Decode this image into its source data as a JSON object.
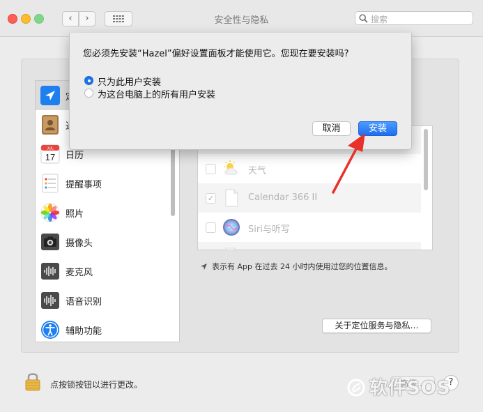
{
  "window": {
    "title": "安全性与隐私"
  },
  "toolbar": {
    "search_placeholder": "搜索",
    "back_glyph": "‹",
    "forward_glyph": "›"
  },
  "sidebar": {
    "items": [
      {
        "label": "定",
        "icon": "location-arrow-icon",
        "selected": true
      },
      {
        "label": "通",
        "icon": "contacts-icon"
      },
      {
        "label": "日历",
        "icon": "calendar-icon",
        "calendar_month": "JUL",
        "calendar_day": "17"
      },
      {
        "label": "提醒事项",
        "icon": "reminders-icon"
      },
      {
        "label": "照片",
        "icon": "photos-icon"
      },
      {
        "label": "摄像头",
        "icon": "camera-icon"
      },
      {
        "label": "麦克风",
        "icon": "microphone-icon"
      },
      {
        "label": "语音识别",
        "icon": "speech-recognition-icon"
      },
      {
        "label": "辅助功能",
        "icon": "accessibility-icon"
      }
    ]
  },
  "app_list": {
    "rows": [
      {
        "label": "天气",
        "checked": false,
        "icon": "weather-icon"
      },
      {
        "label": "Calendar 366 II",
        "checked": true,
        "check_glyph": "✓",
        "icon": "document-icon"
      },
      {
        "label": "Siri与听写",
        "checked": false,
        "icon": "siri-icon"
      }
    ]
  },
  "location_note": "表示有 App 在过去 24 小时内使用过您的位置信息。",
  "about_button": "关于定位服务与隐私…",
  "footer": {
    "lock_text": "点按锁按钮以进行更改。",
    "advanced_button": "高级…",
    "help_button": "?"
  },
  "watermark": "软件SOS",
  "dialog": {
    "message": "您必须先安装“Hazel”偏好设置面板才能使用它。您现在要安装吗?",
    "options": [
      {
        "label": "只为此用户安装",
        "selected": true
      },
      {
        "label": "为这台电脑上的所有用户安装",
        "selected": false
      }
    ],
    "cancel_label": "取消",
    "install_label": "安装"
  },
  "colors": {
    "accent": "#1a73e8",
    "annotation_arrow": "#e8312b"
  }
}
